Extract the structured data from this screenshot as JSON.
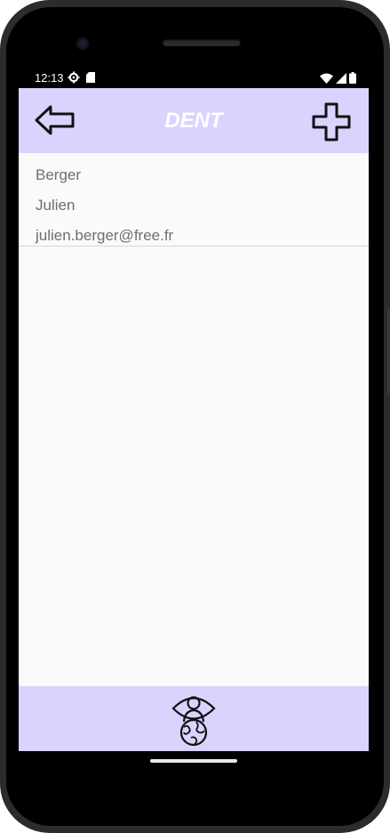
{
  "status_bar": {
    "time": "12:13",
    "icons": [
      "gear-icon",
      "sd-card-icon",
      "wifi-icon",
      "signal-icon",
      "battery-icon"
    ]
  },
  "app_bar": {
    "title": "DENT",
    "back_icon": "arrow-left-icon",
    "add_icon": "plus-icon",
    "background": "#dcd2fe"
  },
  "contacts": [
    {
      "last_name": "Berger",
      "first_name": "Julien",
      "email": "julien.berger@free.fr"
    }
  ],
  "bottom_bar": {
    "logo_icon": "eye-globe-person-icon",
    "background": "#dcd2fe"
  }
}
